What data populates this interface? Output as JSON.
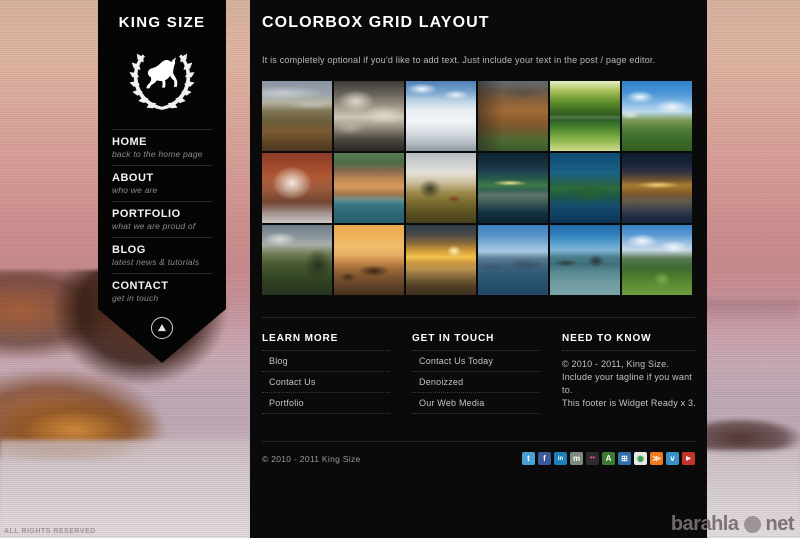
{
  "site": {
    "brand": "KING SIZE",
    "crest_icon": "laurel-wreath-horse-crest-icon",
    "scroll_icon": "scroll-up-arrow-icon"
  },
  "sidebar": {
    "items": [
      {
        "label": "HOME",
        "sub": "back to the home page"
      },
      {
        "label": "ABOUT",
        "sub": "who we are"
      },
      {
        "label": "PORTFOLIO",
        "sub": "what we are proud of"
      },
      {
        "label": "BLOG",
        "sub": "latest news & tutorials"
      },
      {
        "label": "CONTACT",
        "sub": "get in touch"
      }
    ]
  },
  "main": {
    "title": "COLORBOX GRID LAYOUT",
    "intro": "It is completely optional if you'd like to add text.  Just include your text in the post / page editor.",
    "gallery": {
      "columns": 6,
      "rows": 3,
      "tiles": [
        {
          "name": "moorland-valley-dusk",
          "alt": "Brown moorland valley under grey clouds"
        },
        {
          "name": "storm-clouds-mountain",
          "alt": "Dramatic storm clouds over dark mountain"
        },
        {
          "name": "snowy-mountain-range",
          "alt": "Snow covered mountain range, blue sky"
        },
        {
          "name": "clifftop-ruined-fortress",
          "alt": "Ruined stone fortress on orange cliff"
        },
        {
          "name": "green-river-reflection",
          "alt": "Lush green trees reflected in still river"
        },
        {
          "name": "green-hill-blue-sky",
          "alt": "Green hillside with bright cumulus clouds"
        },
        {
          "name": "blossom-tree-infrared",
          "alt": "White blossom tree against red-brown field"
        },
        {
          "name": "lakeside-village-italy",
          "alt": "Colourful lakeside village buildings"
        },
        {
          "name": "lone-tree-red-barn",
          "alt": "Lone tree and red roofed barn at dusk"
        },
        {
          "name": "lit-island-night-lake",
          "alt": "Illuminated island on a dark lake at night"
        },
        {
          "name": "forested-peninsula-lake",
          "alt": "Forested peninsula in deep blue lake"
        },
        {
          "name": "golden-city-night-river",
          "alt": "Golden city skyline reflected at night"
        },
        {
          "name": "coastal-headland-path",
          "alt": "Dark green headland and winding coast path"
        },
        {
          "name": "orange-sunset-sea-rocks",
          "alt": "Orange sunset over sea stacks"
        },
        {
          "name": "golden-sunset-reflection",
          "alt": "Golden sunset reflected on calm water"
        },
        {
          "name": "blue-lake-distant-hills",
          "alt": "Blue lake with distant hazy hills"
        },
        {
          "name": "rocky-islets-clear-water",
          "alt": "Rocky islets in clear turquoise water"
        },
        {
          "name": "green-valley-cloud-peaks",
          "alt": "Green valley beneath cloud topped peaks"
        }
      ]
    }
  },
  "footer": {
    "columns": [
      {
        "title": "LEARN MORE",
        "links": [
          "Blog",
          "Contact Us",
          "Portfolio"
        ]
      },
      {
        "title": "GET IN TOUCH",
        "links": [
          "Contact Us Today",
          "Denoizzed",
          "Our Web Media"
        ]
      }
    ],
    "need_to_know": {
      "title": "NEED TO KNOW",
      "lines": [
        "© 2010 - 2011, King Size.",
        "Include your tagline if you want to.",
        "This footer is Widget Ready x 3."
      ]
    },
    "copyright": "© 2010 - 2011 King Size",
    "socials": [
      {
        "name": "twitter-icon",
        "glyph": "t",
        "color": "#4a9fd4"
      },
      {
        "name": "facebook-icon",
        "glyph": "f",
        "color": "#3b5998"
      },
      {
        "name": "linkedin-icon",
        "glyph": "in",
        "color": "#1c7fb5"
      },
      {
        "name": "myspace-icon",
        "glyph": "m",
        "color": "#7d8a7d"
      },
      {
        "name": "flickr-icon",
        "glyph": "••",
        "color": "#2b2b2b"
      },
      {
        "name": "aim-icon",
        "glyph": "A",
        "color": "#3f7a34"
      },
      {
        "name": "windows-icon",
        "glyph": "⊞",
        "color": "#2f6fae"
      },
      {
        "name": "chrome-icon",
        "glyph": "◉",
        "color": "#e8e8e8"
      },
      {
        "name": "rss-icon",
        "glyph": "≫",
        "color": "#f07a1c"
      },
      {
        "name": "vimeo-icon",
        "glyph": "v",
        "color": "#3b8fc4"
      },
      {
        "name": "youtube-icon",
        "glyph": "▶",
        "color": "#c3352b"
      }
    ]
  },
  "watermarks": {
    "left": "ALL RIGHTS RESERVED",
    "right_a": "barahla",
    "right_b": "net"
  }
}
